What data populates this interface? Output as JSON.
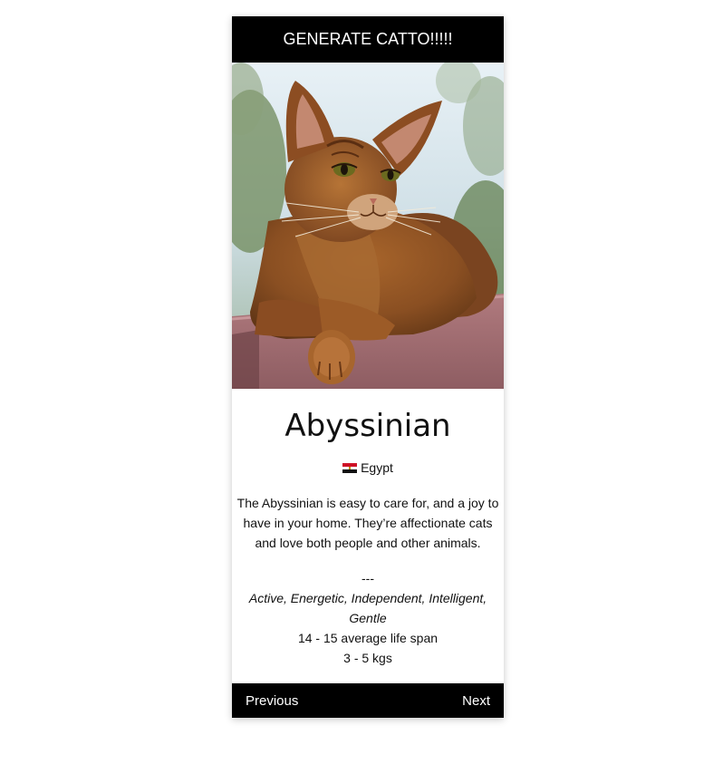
{
  "header": {
    "generate_label": "GENERATE CATTO!!!!!"
  },
  "cat": {
    "image_alt": "Abyssinian",
    "breed": "Abyssinian",
    "origin": {
      "flag_icon": "egypt-flag-icon",
      "country": "Egypt"
    },
    "description": "The Abyssinian is easy to care for, and a joy to have in your home. They’re affectionate cats and love both people and other animals.",
    "separator": "---",
    "temperament": "Active, Energetic, Independent, Intelligent, Gentle",
    "life_span": "14 - 15 average life span",
    "weight": "3 - 5 kgs"
  },
  "nav": {
    "previous_label": "Previous",
    "next_label": "Next"
  },
  "colors": {
    "bar_background": "#000000",
    "bar_text": "#ffffff",
    "page_background": "#ffffff"
  }
}
